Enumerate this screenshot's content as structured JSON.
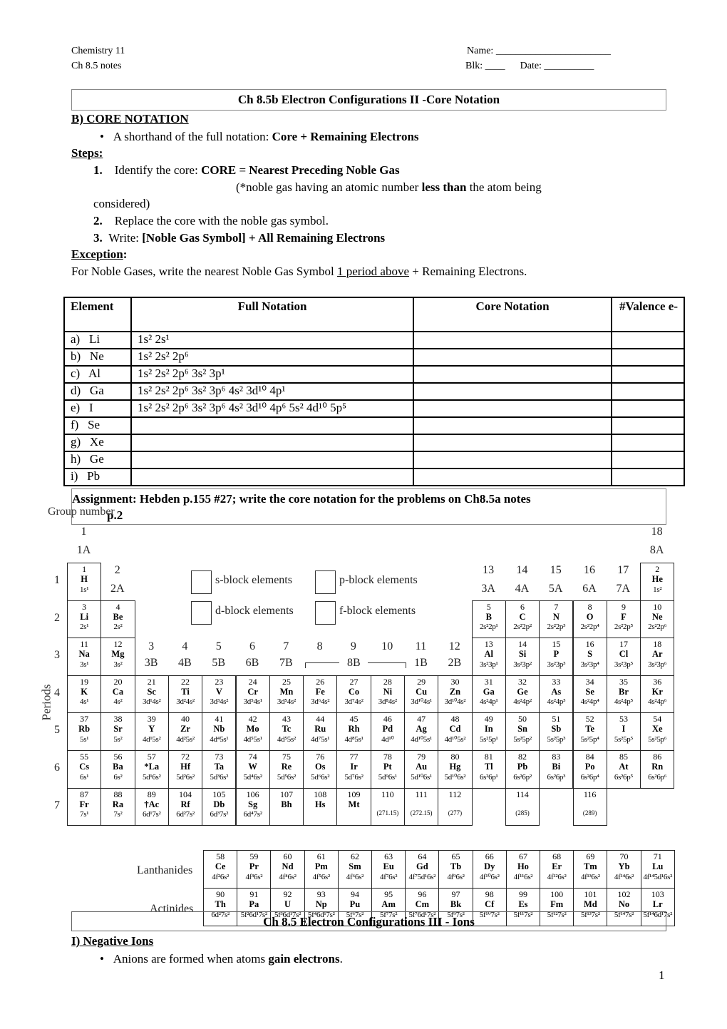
{
  "header": {
    "course": "Chemistry 11",
    "notes": "Ch 8.5 notes",
    "name": "Name: _______________________",
    "blk_date": "Blk: ____      Date: __________"
  },
  "title": "Ch 8.5b  Electron Configurations II -Core Notation",
  "sectionB": "B)  CORE NOTATION",
  "bullet1_pre": "A shorthand of the full notation:  ",
  "bullet1_bold": "Core + Remaining Electrons",
  "steps_label": "Steps:",
  "step1_num": "1.",
  "step1_pre": "Identify the core:  ",
  "step1_bold1": "CORE",
  "step1_mid": " = ",
  "step1_bold2": "Nearest Preceding Noble Gas",
  "step1_note_pre": "(*noble gas having an atomic number ",
  "step1_note_bold": "less than",
  "step1_note_post": " the atom being",
  "step1_note_cont": "considered)",
  "step2_num": "2.",
  "step2": "Replace the core with the noble gas symbol.",
  "step3_num": "3.",
  "step3_pre": "Write:  ",
  "step3_bold": "[Noble Gas Symbol] + All Remaining Electrons",
  "exception_label": "Exception",
  "exception_pre": "For Noble Gases, write the nearest Noble Gas Symbol ",
  "exception_u": "1 period above",
  "exception_post": "  + Remaining Electrons.",
  "table": {
    "headers": [
      "Element",
      "Full Notation",
      "Core Notation",
      "#Valence e-"
    ],
    "rows": [
      {
        "el": "a)   Li",
        "full": "1s² 2s¹"
      },
      {
        "el": "b)   Ne",
        "full": "1s² 2s² 2p⁶"
      },
      {
        "el": "c)   Al",
        "full": "1s² 2s² 2p⁶ 3s² 3p¹"
      },
      {
        "el": "d)   Ga",
        "full": "1s² 2s² 2p⁶ 3s² 3p⁶ 4s² 3d¹⁰ 4p¹"
      },
      {
        "el": "e)   I",
        "full": "1s² 2s² 2p⁶ 3s² 3p⁶ 4s² 3d¹⁰ 4p⁶ 5s² 4d¹⁰ 5p⁵"
      },
      {
        "el": "f)   Se",
        "full": ""
      },
      {
        "el": "g)   Xe",
        "full": ""
      },
      {
        "el": "h)   Ge",
        "full": ""
      },
      {
        "el": "i)   Pb",
        "full": ""
      }
    ]
  },
  "assignment": "Assignment:    Hebden p.155 #27;  write the core notation for the problems on Ch8.5a notes",
  "assignment_cont": "p.2",
  "periodic_table": {
    "group_number_label": "Group number",
    "periods_label": "Periods",
    "legend": [
      "s-block elements",
      "p-block elements",
      "d-block elements",
      "f-block elements"
    ],
    "group_labels": [
      {
        "g": 1,
        "n": "1",
        "a": "1A"
      },
      {
        "g": 2,
        "n": "2",
        "a": "2A"
      },
      {
        "g": 3,
        "n": "3",
        "a": "3B"
      },
      {
        "g": 4,
        "n": "4",
        "a": "4B"
      },
      {
        "g": 5,
        "n": "5",
        "a": "5B"
      },
      {
        "g": 6,
        "n": "6",
        "a": "6B"
      },
      {
        "g": 7,
        "n": "7",
        "a": "7B"
      },
      {
        "g": 8,
        "n": "8",
        "a": ""
      },
      {
        "g": 9,
        "n": "9",
        "a": "8B"
      },
      {
        "g": 10,
        "n": "10",
        "a": ""
      },
      {
        "g": 11,
        "n": "11",
        "a": "1B"
      },
      {
        "g": 12,
        "n": "12",
        "a": "2B"
      },
      {
        "g": 13,
        "n": "13",
        "a": "3A"
      },
      {
        "g": 14,
        "n": "14",
        "a": "4A"
      },
      {
        "g": 15,
        "n": "15",
        "a": "5A"
      },
      {
        "g": 16,
        "n": "16",
        "a": "6A"
      },
      {
        "g": 17,
        "n": "17",
        "a": "7A"
      },
      {
        "g": 18,
        "n": "18",
        "a": "8A"
      }
    ],
    "periods": [
      "1",
      "2",
      "3",
      "4",
      "5",
      "6",
      "7"
    ],
    "elements": [
      [
        1,
        "H",
        "1s¹",
        1,
        1
      ],
      [
        2,
        "He",
        "1s²",
        18,
        1
      ],
      [
        3,
        "Li",
        "2s¹",
        1,
        2
      ],
      [
        4,
        "Be",
        "2s²",
        2,
        2
      ],
      [
        5,
        "B",
        "2s²2p¹",
        13,
        2
      ],
      [
        6,
        "C",
        "2s²2p²",
        14,
        2
      ],
      [
        7,
        "N",
        "2s²2p³",
        15,
        2
      ],
      [
        8,
        "O",
        "2s²2p⁴",
        16,
        2
      ],
      [
        9,
        "F",
        "2s²2p⁵",
        17,
        2
      ],
      [
        10,
        "Ne",
        "2s²2p⁶",
        18,
        2
      ],
      [
        11,
        "Na",
        "3s¹",
        1,
        3
      ],
      [
        12,
        "Mg",
        "3s²",
        2,
        3
      ],
      [
        13,
        "Al",
        "3s²3p¹",
        13,
        3
      ],
      [
        14,
        "Si",
        "3s²3p²",
        14,
        3
      ],
      [
        15,
        "P",
        "3s²3p³",
        15,
        3
      ],
      [
        16,
        "S",
        "3s²3p⁴",
        16,
        3
      ],
      [
        17,
        "Cl",
        "3s²3p⁵",
        17,
        3
      ],
      [
        18,
        "Ar",
        "3s²3p⁶",
        18,
        3
      ],
      [
        19,
        "K",
        "4s¹",
        1,
        4
      ],
      [
        20,
        "Ca",
        "4s²",
        2,
        4
      ],
      [
        21,
        "Sc",
        "3d¹4s²",
        3,
        4
      ],
      [
        22,
        "Ti",
        "3d²4s²",
        4,
        4
      ],
      [
        23,
        "V",
        "3d³4s²",
        5,
        4
      ],
      [
        24,
        "Cr",
        "3d⁵4s¹",
        6,
        4
      ],
      [
        25,
        "Mn",
        "3d⁵4s²",
        7,
        4
      ],
      [
        26,
        "Fe",
        "3d⁶4s²",
        8,
        4
      ],
      [
        27,
        "Co",
        "3d⁷4s²",
        9,
        4
      ],
      [
        28,
        "Ni",
        "3d⁸4s²",
        10,
        4
      ],
      [
        29,
        "Cu",
        "3d¹⁰4s¹",
        11,
        4
      ],
      [
        30,
        "Zn",
        "3d¹⁰4s²",
        12,
        4
      ],
      [
        31,
        "Ga",
        "4s²4p¹",
        13,
        4
      ],
      [
        32,
        "Ge",
        "4s²4p²",
        14,
        4
      ],
      [
        33,
        "As",
        "4s²4p³",
        15,
        4
      ],
      [
        34,
        "Se",
        "4s²4p⁴",
        16,
        4
      ],
      [
        35,
        "Br",
        "4s²4p⁵",
        17,
        4
      ],
      [
        36,
        "Kr",
        "4s²4p⁶",
        18,
        4
      ],
      [
        37,
        "Rb",
        "5s¹",
        1,
        5
      ],
      [
        38,
        "Sr",
        "5s²",
        2,
        5
      ],
      [
        39,
        "Y",
        "4d¹5s²",
        3,
        5
      ],
      [
        40,
        "Zr",
        "4d²5s²",
        4,
        5
      ],
      [
        41,
        "Nb",
        "4d⁴5s¹",
        5,
        5
      ],
      [
        42,
        "Mo",
        "4d⁵5s¹",
        6,
        5
      ],
      [
        43,
        "Tc",
        "4d⁵5s²",
        7,
        5
      ],
      [
        44,
        "Ru",
        "4d⁷5s¹",
        8,
        5
      ],
      [
        45,
        "Rh",
        "4d⁸5s¹",
        9,
        5
      ],
      [
        46,
        "Pd",
        "4d¹⁰",
        10,
        5
      ],
      [
        47,
        "Ag",
        "4d¹⁰5s¹",
        11,
        5
      ],
      [
        48,
        "Cd",
        "4d¹⁰5s²",
        12,
        5
      ],
      [
        49,
        "In",
        "5s²5p¹",
        13,
        5
      ],
      [
        50,
        "Sn",
        "5s²5p²",
        14,
        5
      ],
      [
        51,
        "Sb",
        "5s²5p³",
        15,
        5
      ],
      [
        52,
        "Te",
        "5s²5p⁴",
        16,
        5
      ],
      [
        53,
        "I",
        "5s²5p⁵",
        17,
        5
      ],
      [
        54,
        "Xe",
        "5s²5p⁶",
        18,
        5
      ],
      [
        55,
        "Cs",
        "6s¹",
        1,
        6
      ],
      [
        56,
        "Ba",
        "6s²",
        2,
        6
      ],
      [
        57,
        "*La",
        "5d¹6s²",
        3,
        6
      ],
      [
        72,
        "Hf",
        "5d²6s²",
        4,
        6
      ],
      [
        73,
        "Ta",
        "5d³6s²",
        5,
        6
      ],
      [
        74,
        "W",
        "5d⁴6s²",
        6,
        6
      ],
      [
        75,
        "Re",
        "5d⁵6s²",
        7,
        6
      ],
      [
        76,
        "Os",
        "5d⁶6s²",
        8,
        6
      ],
      [
        77,
        "Ir",
        "5d⁷6s²",
        9,
        6
      ],
      [
        78,
        "Pt",
        "5d⁹6s¹",
        10,
        6
      ],
      [
        79,
        "Au",
        "5d¹⁰6s¹",
        11,
        6
      ],
      [
        80,
        "Hg",
        "5d¹⁰6s²",
        12,
        6
      ],
      [
        81,
        "Tl",
        "6s²6p¹",
        13,
        6
      ],
      [
        82,
        "Pb",
        "6s²6p²",
        14,
        6
      ],
      [
        83,
        "Bi",
        "6s²6p³",
        15,
        6
      ],
      [
        84,
        "Po",
        "6s²6p⁴",
        16,
        6
      ],
      [
        85,
        "At",
        "6s²6p⁵",
        17,
        6
      ],
      [
        86,
        "Rn",
        "6s²6p⁶",
        18,
        6
      ],
      [
        87,
        "Fr",
        "7s¹",
        1,
        7
      ],
      [
        88,
        "Ra",
        "7s²",
        2,
        7
      ],
      [
        89,
        "†Ac",
        "6d¹7s²",
        3,
        7
      ],
      [
        104,
        "Rf",
        "6d²7s²",
        4,
        7
      ],
      [
        105,
        "Db",
        "6d³7s²",
        5,
        7
      ],
      [
        106,
        "Sg",
        "6d⁴7s²",
        6,
        7
      ],
      [
        107,
        "Bh",
        "",
        7,
        7
      ],
      [
        108,
        "Hs",
        "",
        8,
        7
      ],
      [
        109,
        "Mt",
        "",
        9,
        7
      ],
      [
        110,
        "",
        "(271.15)",
        10,
        7
      ],
      [
        111,
        "",
        "(272.15)",
        11,
        7
      ],
      [
        112,
        "",
        "(277)",
        12,
        7
      ],
      [
        114,
        "",
        "(285)",
        14,
        7
      ],
      [
        116,
        "",
        "(289)",
        16,
        7
      ]
    ],
    "lanthanides_label": "Lanthanides",
    "actinides_label": "Actinides",
    "lanthanides": [
      [
        58,
        "Ce",
        "4f²6s²"
      ],
      [
        59,
        "Pr",
        "4f³6s²"
      ],
      [
        60,
        "Nd",
        "4f⁴6s²"
      ],
      [
        61,
        "Pm",
        "4f⁵6s²"
      ],
      [
        62,
        "Sm",
        "4f⁶6s²"
      ],
      [
        63,
        "Eu",
        "4f⁷6s²"
      ],
      [
        64,
        "Gd",
        "4f⁷5d¹6s²"
      ],
      [
        65,
        "Tb",
        "4f⁹6s²"
      ],
      [
        66,
        "Dy",
        "4f¹⁰6s²"
      ],
      [
        67,
        "Ho",
        "4f¹¹6s²"
      ],
      [
        68,
        "Er",
        "4f¹²6s²"
      ],
      [
        69,
        "Tm",
        "4f¹³6s²"
      ],
      [
        70,
        "Yb",
        "4f¹⁴6s²"
      ],
      [
        71,
        "Lu",
        "4f¹⁴5d¹6s²"
      ]
    ],
    "actinides": [
      [
        90,
        "Th",
        "6d²7s²"
      ],
      [
        91,
        "Pa",
        "5f²6d¹7s²"
      ],
      [
        92,
        "U",
        "5f³6d¹7s²"
      ],
      [
        93,
        "Np",
        "5f⁴6d¹7s²"
      ],
      [
        94,
        "Pu",
        "5f⁶7s²"
      ],
      [
        95,
        "Am",
        "5f⁷7s²"
      ],
      [
        96,
        "Cm",
        "5f⁷6d¹7s²"
      ],
      [
        97,
        "Bk",
        "5f⁹7s²"
      ],
      [
        98,
        "Cf",
        "5f¹⁰7s²"
      ],
      [
        99,
        "Es",
        "5f¹¹7s²"
      ],
      [
        100,
        "Fm",
        "5f¹²7s²"
      ],
      [
        101,
        "Md",
        "5f¹³7s²"
      ],
      [
        102,
        "No",
        "5f¹⁴7s²"
      ],
      [
        103,
        "Lr",
        "5f¹⁴6d¹7s²"
      ]
    ]
  },
  "title2": "Ch 8.5 Electron Configurations III - Ions",
  "sectionI": "I) Negative Ions",
  "bulletI_pre": "Anions are formed when atoms ",
  "bulletI_bold": "gain electrons",
  "bulletI_post": ".",
  "page_number": "1"
}
